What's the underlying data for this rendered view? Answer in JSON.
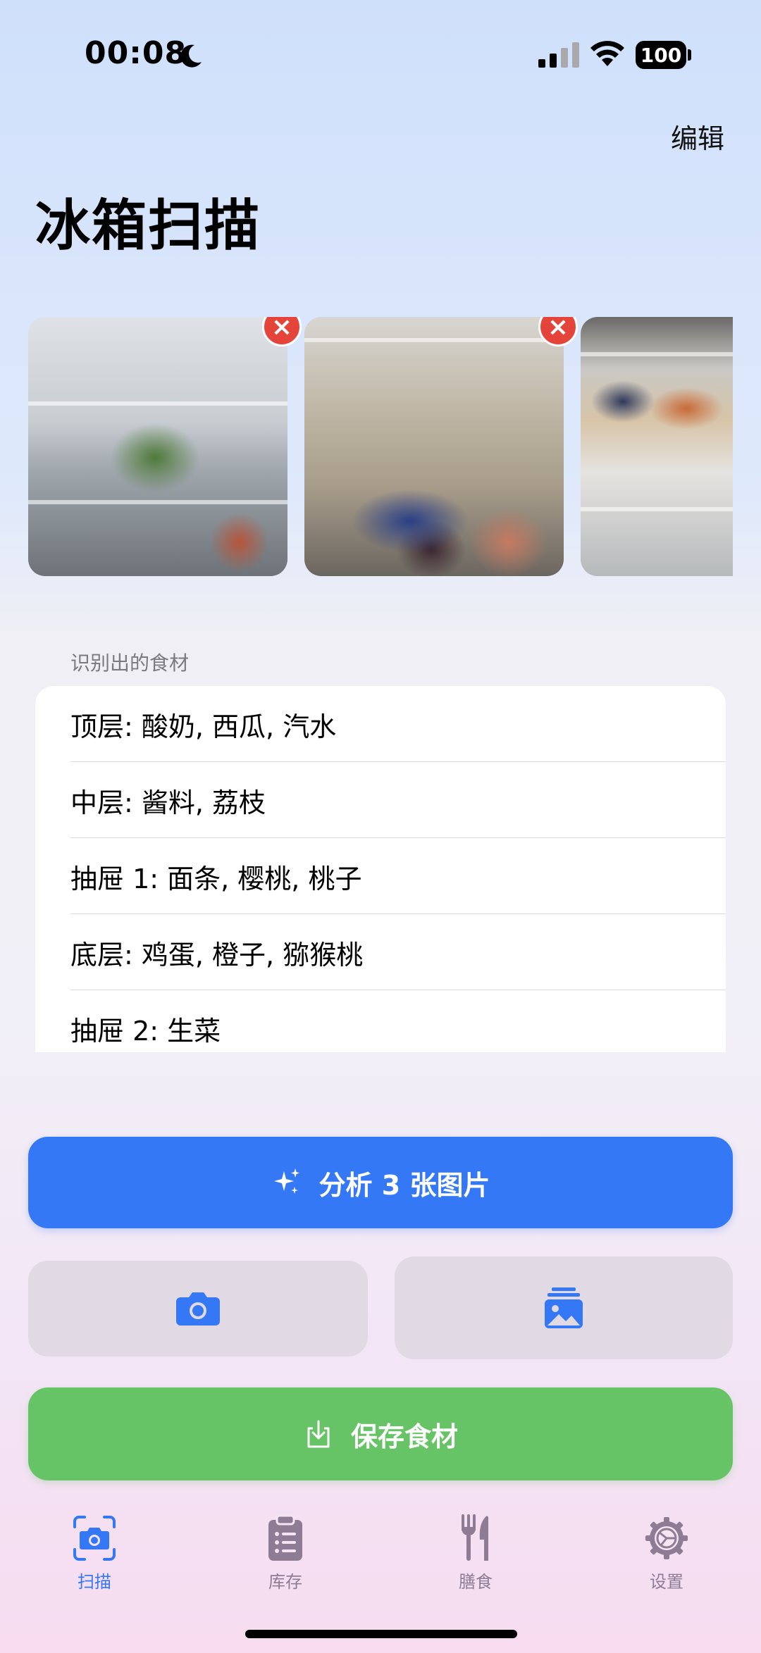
{
  "status_bar": {
    "time": "00:08",
    "battery": "100"
  },
  "header": {
    "edit_label": "编辑",
    "title": "冰箱扫描"
  },
  "photos": [
    {
      "remove_icon": "×"
    },
    {
      "remove_icon": "×"
    },
    {
      "remove_icon": "×"
    }
  ],
  "ingredients": {
    "section_label": "识别出的食材",
    "items": [
      "顶层: 酸奶, 西瓜, 汽水",
      "中层: 酱料, 荔枝",
      "抽屉 1: 面条, 樱桃, 桃子",
      "底层: 鸡蛋, 橙子, 猕猴桃",
      "抽屉 2: 生菜"
    ]
  },
  "actions": {
    "analyze_label": "分析 3 张图片",
    "save_label": "保存食材"
  },
  "tab_bar": {
    "tabs": [
      {
        "label": "扫描",
        "icon": "scan-camera-icon",
        "active": true
      },
      {
        "label": "库存",
        "icon": "clipboard-list-icon",
        "active": false
      },
      {
        "label": "膳食",
        "icon": "fork-knife-icon",
        "active": false
      },
      {
        "label": "设置",
        "icon": "gear-icon",
        "active": false
      }
    ]
  },
  "colors": {
    "accent_blue": "#3478f6",
    "save_green": "#66c466",
    "remove_red": "#e5443b",
    "inactive_tab": "#8d7c94"
  }
}
